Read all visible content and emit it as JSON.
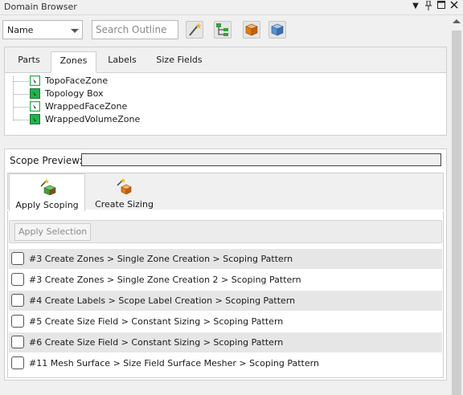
{
  "window": {
    "title": "Domain Browser"
  },
  "toolbar": {
    "sort_select": {
      "value": "Name"
    },
    "search": {
      "placeholder": "Search Outline"
    },
    "buttons": [
      "magic-wand-icon",
      "tree-expand-icon",
      "orange-cube-icon",
      "blue-cube-icon"
    ]
  },
  "top_tabs": [
    "Parts",
    "Zones",
    "Labels",
    "Size Fields"
  ],
  "active_top_tab": "Zones",
  "zones": [
    {
      "label": "TopoFaceZone",
      "icon": "face-zone-icon"
    },
    {
      "label": "Topology Box",
      "icon": "volume-zone-icon"
    },
    {
      "label": "WrappedFaceZone",
      "icon": "face-zone-icon"
    },
    {
      "label": "WrappedVolumeZone",
      "icon": "volume-zone-icon"
    }
  ],
  "scope": {
    "preview_label": "Scope Preview:",
    "tabs": [
      {
        "label": "Apply Scoping",
        "icon": "apply-scoping-icon"
      },
      {
        "label": "Create Sizing",
        "icon": "create-sizing-icon"
      }
    ],
    "apply_button": "Apply Selection",
    "patterns": [
      "#3 Create Zones > Single Zone Creation > Scoping Pattern",
      "#3 Create Zones > Single Zone Creation 2 > Scoping Pattern",
      "#4 Create Labels > Scope Label Creation > Scoping Pattern",
      "#5 Create Size Field > Constant Sizing > Scoping Pattern",
      "#6 Create Size Field > Constant Sizing > Scoping Pattern",
      "#11 Mesh Surface > Size Field Surface Mesher > Scoping Pattern"
    ]
  },
  "colors": {
    "zone_green": "#22b14c",
    "row_alt": "#e6e6e6",
    "border": "#cfcfcf"
  }
}
